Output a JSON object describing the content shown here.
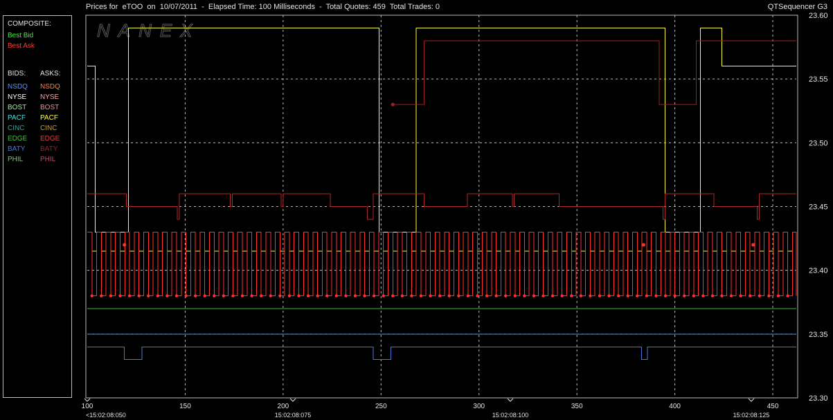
{
  "header": {
    "title": "Prices for  eTOO  on  10/07/2011  -  Elapsed Time: 100 Milliseconds  -  Total Quotes: 459  Total Trades: 0",
    "app_name": "QTSequencer G3"
  },
  "watermark": "NANEX",
  "legend": {
    "composite_label": "COMPOSITE:",
    "best_bid": {
      "label": "Best Bid",
      "color": "#3cf03c"
    },
    "best_ask": {
      "label": "Best Ask",
      "color": "#ff3b3b"
    },
    "bids_label": "BIDS:",
    "asks_label": "ASKS:",
    "bids": [
      {
        "label": "NSDQ",
        "color": "#5a8cff"
      },
      {
        "label": "NYSE",
        "color": "#ffffff"
      },
      {
        "label": "BOST",
        "color": "#a6e6a6"
      },
      {
        "label": "PACF",
        "color": "#4fe0e0"
      },
      {
        "label": "CINC",
        "color": "#2fa8a8"
      },
      {
        "label": "EDGE",
        "color": "#3cc03c"
      },
      {
        "label": "BATY",
        "color": "#4a78d8"
      },
      {
        "label": "PHIL",
        "color": "#8fbf8f"
      }
    ],
    "asks": [
      {
        "label": "NSDQ",
        "color": "#ff7a3c"
      },
      {
        "label": "NYSE",
        "color": "#ffa0a0"
      },
      {
        "label": "BOST",
        "color": "#ff8a8a"
      },
      {
        "label": "PACF",
        "color": "#ffff40"
      },
      {
        "label": "CINC",
        "color": "#c8a020"
      },
      {
        "label": "EDGE",
        "color": "#d84040"
      },
      {
        "label": "BATY",
        "color": "#a02020"
      },
      {
        "label": "PHIL",
        "color": "#c84070"
      }
    ]
  },
  "chart_data": {
    "type": "line",
    "xlim": [
      100,
      462
    ],
    "ylim": [
      23.3,
      23.6
    ],
    "grid": true,
    "x_ticks": [
      100,
      150,
      200,
      250,
      300,
      350,
      400,
      450
    ],
    "y_ticks": [
      "23.60",
      "23.55",
      "23.50",
      "23.45",
      "23.40",
      "23.35",
      "23.30"
    ],
    "time_labels": [
      {
        "x": 100,
        "label": "<15:02:08:050"
      },
      {
        "x": 205,
        "label": "15:02:08:075"
      },
      {
        "x": 316,
        "label": "15:02:08:100"
      },
      {
        "x": 439,
        "label": "15:02:08:125"
      }
    ],
    "series": [
      {
        "key": "pacf_ask",
        "color": "#ffff40",
        "points": [
          [
            100,
            23.56
          ],
          [
            104,
            23.56
          ],
          [
            104,
            23.43
          ],
          [
            121,
            23.43
          ],
          [
            121,
            23.59
          ],
          [
            249,
            23.59
          ],
          [
            249,
            23.43
          ],
          [
            268,
            23.43
          ],
          [
            268,
            23.59
          ],
          [
            395,
            23.59
          ],
          [
            395,
            23.43
          ],
          [
            413,
            23.43
          ],
          [
            413,
            23.59
          ],
          [
            424,
            23.59
          ],
          [
            424,
            23.56
          ],
          [
            462,
            23.56
          ]
        ]
      },
      {
        "key": "pacf_ask_flicker",
        "color": "#ffff40",
        "flicker": {
          "from": 100,
          "to": 462,
          "step": 2.4,
          "high": 23.43,
          "low": 23.415
        }
      },
      {
        "key": "best_ask_flicker",
        "color": "#ff3030",
        "flicker": {
          "from": 100,
          "to": 462,
          "step": 2.4,
          "high": 23.43,
          "low": 23.38
        }
      },
      {
        "key": "edge_ask",
        "color": "#b02828",
        "points": [
          [
            100,
            23.46
          ],
          [
            120,
            23.46
          ],
          [
            120,
            23.45
          ],
          [
            146,
            23.45
          ],
          [
            146,
            23.44
          ],
          [
            147,
            23.44
          ],
          [
            147,
            23.46
          ],
          [
            173,
            23.46
          ],
          [
            173,
            23.45
          ],
          [
            174,
            23.45
          ],
          [
            174,
            23.46
          ],
          [
            199,
            23.46
          ],
          [
            199,
            23.45
          ],
          [
            200,
            23.45
          ],
          [
            200,
            23.46
          ],
          [
            224,
            23.46
          ],
          [
            224,
            23.45
          ],
          [
            243,
            23.45
          ],
          [
            243,
            23.44
          ],
          [
            246,
            23.44
          ],
          [
            246,
            23.46
          ],
          [
            272,
            23.46
          ],
          [
            272,
            23.45
          ],
          [
            294,
            23.45
          ],
          [
            294,
            23.46
          ],
          [
            317,
            23.46
          ],
          [
            317,
            23.45
          ],
          [
            318,
            23.45
          ],
          [
            318,
            23.46
          ],
          [
            341,
            23.46
          ],
          [
            341,
            23.45
          ],
          [
            394,
            23.45
          ],
          [
            394,
            23.44
          ],
          [
            395,
            23.44
          ],
          [
            395,
            23.46
          ],
          [
            420,
            23.46
          ],
          [
            420,
            23.45
          ],
          [
            442,
            23.45
          ],
          [
            442,
            23.44
          ],
          [
            443,
            23.44
          ],
          [
            443,
            23.46
          ],
          [
            462,
            23.46
          ]
        ]
      },
      {
        "key": "baty_ask",
        "color": "#a02020",
        "points": [
          [
            256,
            23.53
          ],
          [
            272,
            23.53
          ],
          [
            272,
            23.58
          ],
          [
            392,
            23.58
          ],
          [
            392,
            23.53
          ],
          [
            411,
            23.53
          ],
          [
            411,
            23.58
          ],
          [
            462,
            23.58
          ]
        ]
      },
      {
        "key": "best_bid",
        "color": "#3cc03c",
        "points": [
          [
            100,
            23.37
          ],
          [
            462,
            23.37
          ]
        ]
      },
      {
        "key": "nsdq_bid",
        "color": "#4a90e0",
        "points": [
          [
            100,
            23.35
          ],
          [
            462,
            23.35
          ]
        ]
      },
      {
        "key": "baty_bid",
        "color": "#4a78d8",
        "points": [
          [
            100,
            23.34
          ],
          [
            119,
            23.34
          ],
          [
            119,
            23.33
          ],
          [
            128,
            23.33
          ],
          [
            128,
            23.34
          ],
          [
            246,
            23.34
          ],
          [
            246,
            23.33
          ],
          [
            255,
            23.33
          ],
          [
            255,
            23.34
          ],
          [
            383,
            23.34
          ],
          [
            383,
            23.33
          ],
          [
            386,
            23.33
          ],
          [
            386,
            23.34
          ],
          [
            462,
            23.34
          ]
        ]
      }
    ],
    "markers": [
      {
        "x": 256,
        "y": 23.53,
        "color": "#a02020"
      },
      {
        "x": 119,
        "y": 23.42,
        "color": "#ff3030"
      },
      {
        "x": 384,
        "y": 23.42,
        "color": "#ff3030"
      },
      {
        "x": 440,
        "y": 23.42,
        "color": "#ff3030"
      }
    ]
  }
}
